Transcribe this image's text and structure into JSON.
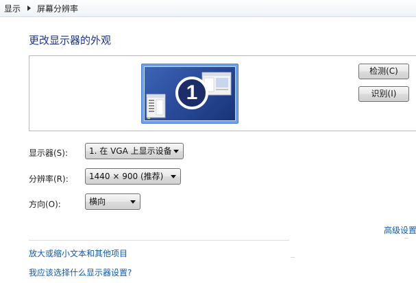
{
  "breadcrumb": {
    "items": [
      "显示",
      "屏幕分辨率"
    ]
  },
  "page": {
    "title": "更改显示器的外观"
  },
  "monitor_panel": {
    "monitor_number": "1",
    "detect_label": "检测(C)",
    "identify_label": "识别(I)"
  },
  "settings": {
    "display": {
      "label": "显示器(S):",
      "value": "1. 在 VGA 上显示设备"
    },
    "resolution": {
      "label": "分辨率(R):",
      "value": "1440 × 900 (推荐)"
    },
    "orientation": {
      "label": "方向(O):",
      "value": "横向"
    }
  },
  "links": {
    "advanced": "高级设置",
    "text_size": "放大或缩小文本和其他项目",
    "which_settings": "我应该选择什么显示器设置?"
  },
  "colors": {
    "title": "#1e3287",
    "link": "#0f5ab4",
    "monitor_frame": "#6fa1e5"
  }
}
